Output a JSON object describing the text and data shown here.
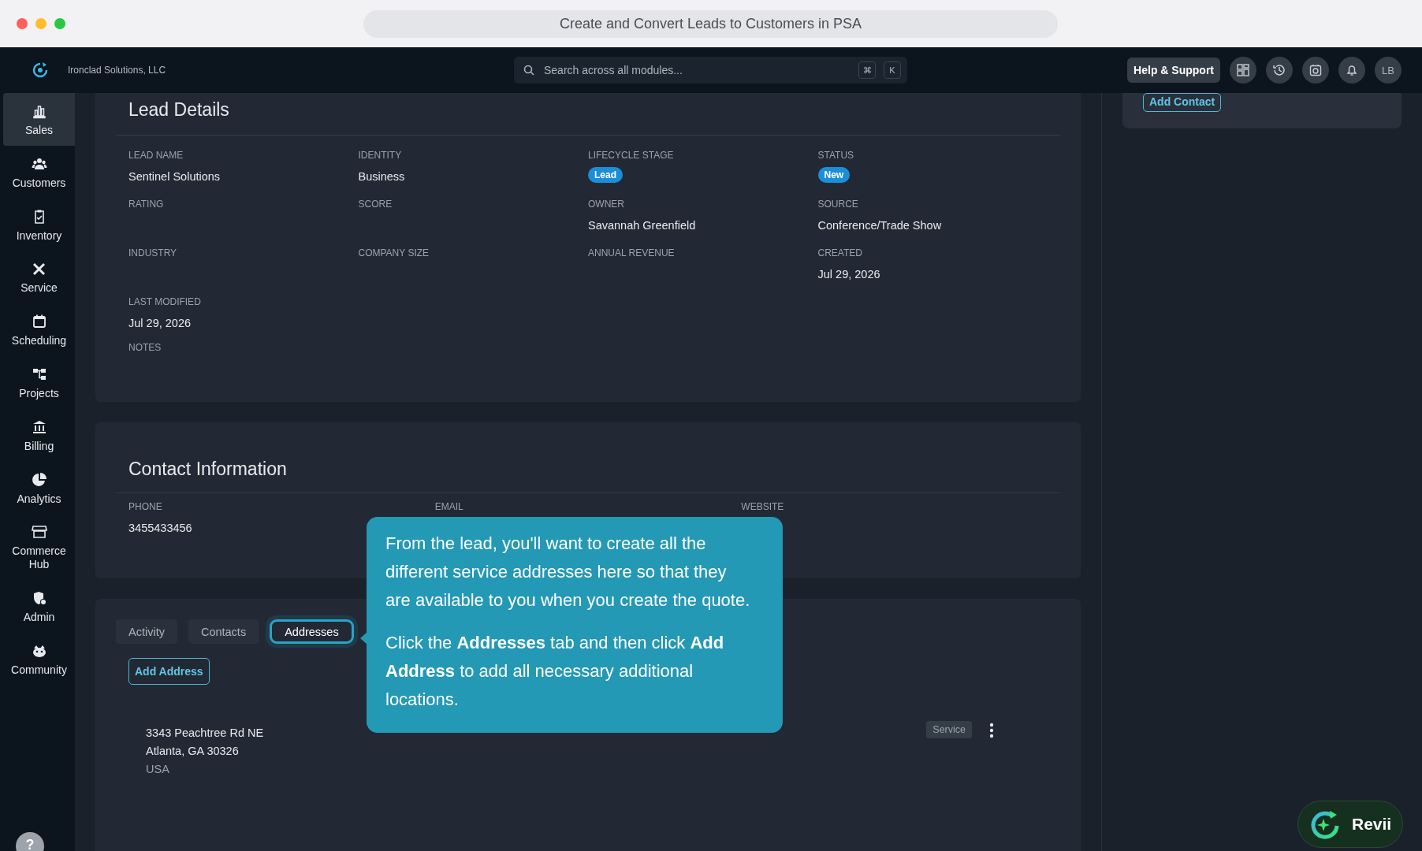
{
  "window": {
    "title": "Create and Convert Leads to Customers in PSA"
  },
  "topbar": {
    "company": "Ironclad Solutions, LLC",
    "search": {
      "placeholder": "Search across all modules...",
      "keys": [
        "⌘",
        "K"
      ]
    },
    "help_button": "Help & Support",
    "avatar": "LB"
  },
  "sidebar": {
    "items": [
      {
        "label": "Sales",
        "selected": true
      },
      {
        "label": "Customers",
        "selected": false
      },
      {
        "label": "Inventory",
        "selected": false
      },
      {
        "label": "Service",
        "selected": false
      },
      {
        "label": "Scheduling",
        "selected": false
      },
      {
        "label": "Projects",
        "selected": false
      },
      {
        "label": "Billing",
        "selected": false
      },
      {
        "label": "Analytics",
        "selected": false
      },
      {
        "label": "Commerce Hub",
        "selected": false
      },
      {
        "label": "Admin",
        "selected": false
      },
      {
        "label": "Community",
        "selected": false
      }
    ],
    "help": "?"
  },
  "lead_details": {
    "title": "Lead Details",
    "fields": [
      {
        "label": "LEAD NAME",
        "value": "Sentinel Solutions",
        "kind": "text"
      },
      {
        "label": "IDENTITY",
        "value": "Business",
        "kind": "text"
      },
      {
        "label": "LIFECYCLE STAGE",
        "value": "Lead",
        "kind": "badge"
      },
      {
        "label": "STATUS",
        "value": "New",
        "kind": "badge"
      },
      {
        "label": "RATING",
        "kind": "text"
      },
      {
        "label": "SCORE",
        "kind": "text"
      },
      {
        "label": "OWNER",
        "value": "Savannah Greenfield",
        "kind": "text"
      },
      {
        "label": "SOURCE",
        "value": "Conference/Trade Show",
        "kind": "text"
      },
      {
        "label": "INDUSTRY",
        "kind": "text"
      },
      {
        "label": "COMPANY SIZE",
        "kind": "text"
      },
      {
        "label": "ANNUAL REVENUE",
        "kind": "text"
      },
      {
        "label": "CREATED",
        "value": "Jul 29, 2026",
        "kind": "text"
      },
      {
        "label": "LAST MODIFIED",
        "value": "Jul 29, 2026",
        "kind": "text"
      },
      {
        "label": "NOTES",
        "kind": "wide"
      }
    ]
  },
  "contact_information": {
    "title": "Contact Information",
    "fields": [
      {
        "label": "PHONE",
        "value": "3455433456"
      },
      {
        "label": "EMAIL"
      },
      {
        "label": "WEBSITE"
      }
    ]
  },
  "tabs": [
    {
      "label": "Activity",
      "selected": false
    },
    {
      "label": "Contacts",
      "selected": false
    },
    {
      "label": "Addresses",
      "selected": true
    }
  ],
  "add_address_button": "Add Address",
  "addresses": [
    {
      "lines": [
        "3343 Peachtree Rd NE",
        "Atlanta, GA 30326"
      ],
      "country": "USA",
      "tag": "Service"
    }
  ],
  "right_panel": {
    "add_contact_button": "Add Contact"
  },
  "tooltip": {
    "paragraphs": [
      "From the lead, you'll want to create all the different service addresses here so that they are available to you when you create the quote.",
      "Click the **Addresses** tab and then click **Add Address** to add all necessary additional locations."
    ]
  },
  "assistant_button": "Revii"
}
